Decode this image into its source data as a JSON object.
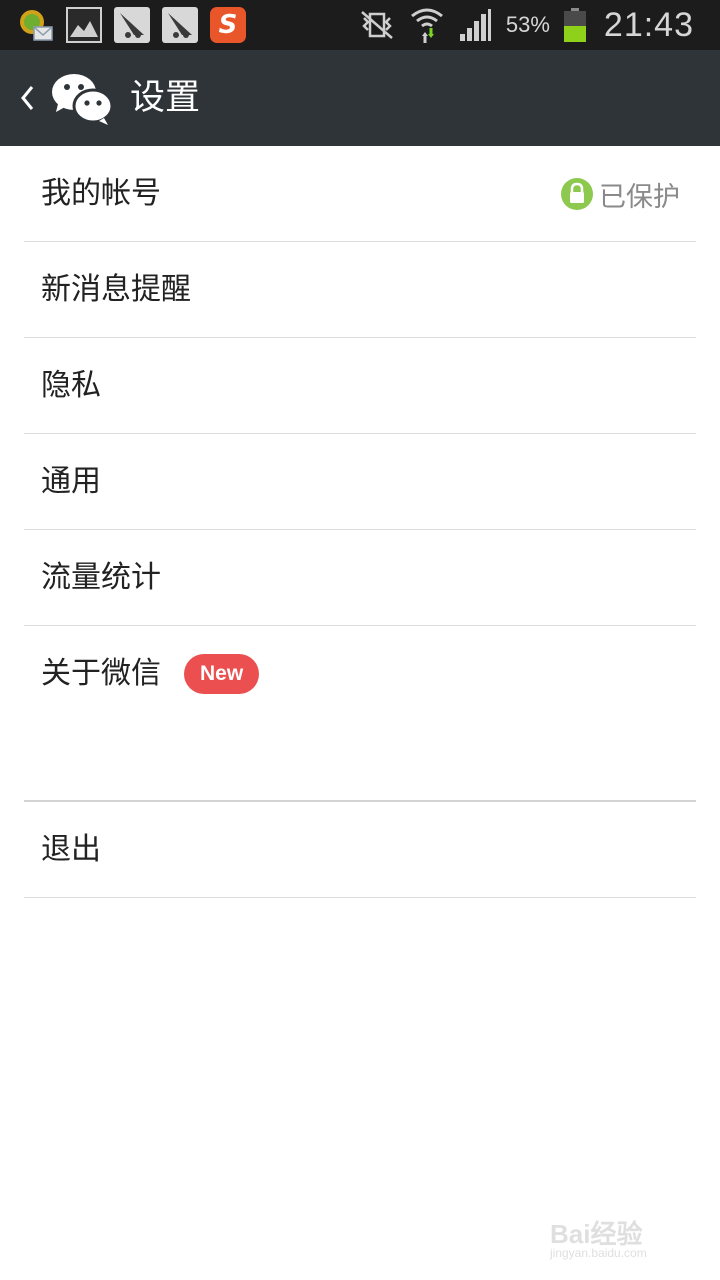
{
  "status_bar": {
    "battery_percent": "53%",
    "time": "21:43",
    "icons": [
      "app-notification-icon",
      "gallery-icon",
      "glider-app-icon",
      "glider-app-icon",
      "sogou-input-icon",
      "vibrate-icon",
      "wifi-icon",
      "signal-icon",
      "battery-icon"
    ]
  },
  "header": {
    "title": "设置",
    "back_icon": "chevron-left-icon",
    "logo_icon": "wechat-logo-icon"
  },
  "settings": {
    "items": [
      {
        "label": "我的帐号",
        "status": "已保护",
        "status_icon": "lock-icon"
      },
      {
        "label": "新消息提醒"
      },
      {
        "label": "隐私"
      },
      {
        "label": "通用"
      },
      {
        "label": "流量统计"
      },
      {
        "label": "关于微信",
        "badge": "New"
      }
    ],
    "logout": "退出"
  },
  "watermark": {
    "brand": "Bai经验",
    "url": "jingyan.baidu.com"
  },
  "colors": {
    "status_bar": "#1c1c1c",
    "title_bar": "#2f3439",
    "badge": "#eb4f4f",
    "lock_badge": "#8dc94f",
    "battery_fill": "#8fd11a"
  }
}
